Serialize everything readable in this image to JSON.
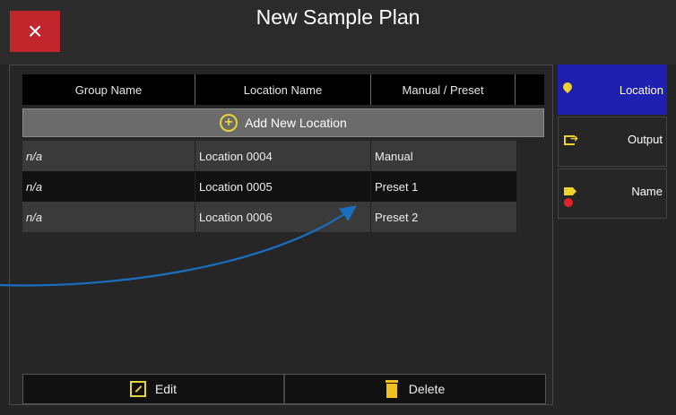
{
  "window": {
    "title": "New Sample Plan"
  },
  "buttons": {
    "close_glyph": "×",
    "edit_label": "Edit",
    "delete_label": "Delete"
  },
  "table": {
    "headers": [
      "Group Name",
      "Location Name",
      "Manual / Preset"
    ],
    "add_label": "Add New Location",
    "rows": [
      {
        "group": "n/a",
        "location": "Location 0004",
        "mode": "Manual"
      },
      {
        "group": "n/a",
        "location": "Location 0005",
        "mode": "Preset 1"
      },
      {
        "group": "n/a",
        "location": "Location 0006",
        "mode": "Preset 2"
      }
    ]
  },
  "sidebar": {
    "tabs": [
      {
        "label": "Location",
        "active": true
      },
      {
        "label": "Output",
        "active": false
      },
      {
        "label": "Name",
        "active": false
      }
    ]
  },
  "colors": {
    "accent_yellow": "#f0d22a",
    "close_red": "#c0262b",
    "active_tab": "#1f1fb0",
    "annotation_arrow": "#1a6fc0"
  }
}
